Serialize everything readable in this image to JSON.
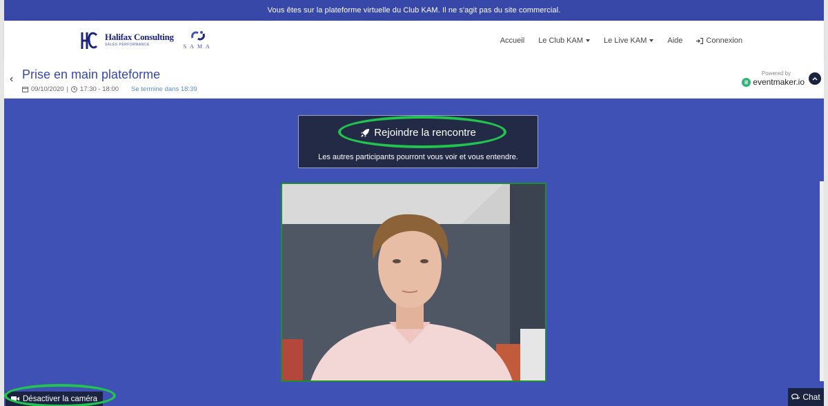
{
  "banner": {
    "text": "Vous êtes sur la plateforme virtuelle du Club KAM. Il ne s'agit pas du site commercial."
  },
  "header": {
    "logo_name": "Halifax Consulting",
    "logo_tagline": "SALES PERFORMANCE",
    "partner_name": "SAMA",
    "nav": [
      {
        "label": "Accueil",
        "dropdown": false
      },
      {
        "label": "Le Club KAM",
        "dropdown": true
      },
      {
        "label": "Le Live KAM",
        "dropdown": true
      },
      {
        "label": "Aide",
        "dropdown": false
      },
      {
        "label": "Connexion",
        "icon": "sign-in-icon"
      }
    ]
  },
  "event": {
    "title": "Prise en main plateforme",
    "date": "09/10/2020",
    "separator": "|",
    "time": "17:30 - 18:00",
    "ends_in": "Se termine dans 18:39",
    "powered_by": "Powered by",
    "provider": "eventmaker.io"
  },
  "meeting": {
    "join_label": "Rejoindre la rencontre",
    "join_note": "Les autres participants pourront vous voir et vous entendre.",
    "camera_label": "Désactiver la caméra",
    "chat_label": "Chat"
  },
  "colors": {
    "brand": "#3f51b5",
    "dark": "#1a2340",
    "highlight": "#22c34e"
  }
}
